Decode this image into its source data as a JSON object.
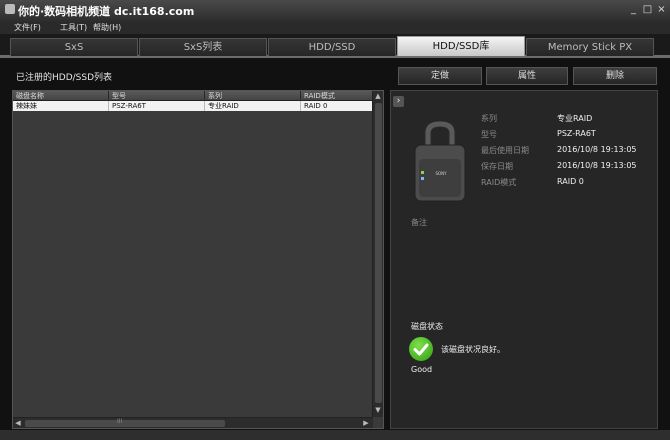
{
  "window": {
    "title": "你的·数码相机频道 dc.it168.com",
    "controls": [
      "_",
      "□",
      "×"
    ]
  },
  "menu": {
    "items": [
      "文件(F)",
      "工具(T)",
      "帮助(H)"
    ]
  },
  "tabs": [
    {
      "label": "SxS",
      "active": false
    },
    {
      "label": "SxS列表",
      "active": false
    },
    {
      "label": "HDD/SSD",
      "active": false
    },
    {
      "label": "HDD/SSD库",
      "active": true
    },
    {
      "label": "Memory Stick PX",
      "active": false
    }
  ],
  "toolbar": {
    "list_title": "已注册的HDD/SSD列表",
    "buttons": [
      "定做",
      "属性",
      "删除"
    ]
  },
  "table": {
    "columns": [
      "磁盘名称",
      "型号",
      "系列",
      "RAID模式"
    ],
    "rows": [
      [
        "辣妹妹",
        "PSZ-RA6T",
        "专业RAID",
        "RAID 0"
      ]
    ],
    "scroll_arrows": {
      "up": "▲",
      "down": "▼",
      "left": "◀",
      "right": "▶",
      "grip": "III"
    }
  },
  "details": {
    "expand_glyph": "›",
    "fields": [
      {
        "label": "系列",
        "value": "专业RAID"
      },
      {
        "label": "型号",
        "value": "PSZ-RA6T"
      },
      {
        "label": "最后使用日期",
        "value": "2016/10/8 19:13:05"
      },
      {
        "label": "保存日期",
        "value": "2016/10/8 19:13:05"
      },
      {
        "label": "RAID模式",
        "value": "RAID 0"
      }
    ],
    "device_brand": "SONY",
    "notes_label": "备注",
    "status_title": "磁盘状态",
    "status_message": "该磁盘状况良好。",
    "status_value": "Good",
    "status_color": "#3aa81a"
  }
}
